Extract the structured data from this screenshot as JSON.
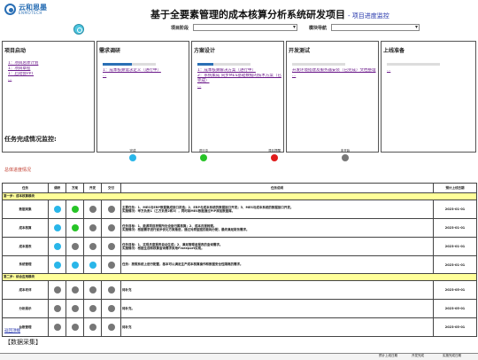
{
  "logo": {
    "main": "云和恩墨",
    "sub": "ENMOTECH"
  },
  "header": {
    "title": "基于全要素管理的成本核算分析系统研发项目",
    "subtitle": "- 项目进度监控"
  },
  "filters": {
    "project_label": "项目阶段",
    "project_value": "",
    "module_label": "模块导航",
    "module_value": ""
  },
  "phases": [
    {
      "title": "项目启动",
      "progress": 0,
      "links": [
        "1：项目总体计划",
        "1：项目章程",
        "1：启动会PPT",
        "..."
      ]
    },
    {
      "title": "需求调研",
      "progress": 0.55,
      "links": [
        "1：成本核算需求定义（进行中）",
        "..."
      ]
    },
    {
      "title": "方案设计",
      "progress": 0.3,
      "links": [
        "1：成本核算解决方案（进行中）",
        "2：系统集成 同步MES基础数据的技术方案（已完成）",
        "..."
      ]
    },
    {
      "title": "开发测试",
      "progress": 0,
      "links": [
        "开发环境搭建及服务器安装（已完成）文档整理",
        "..."
      ]
    },
    {
      "title": "上线准备",
      "progress": 0,
      "links": [
        "..."
      ]
    }
  ],
  "monitor": {
    "title": "任务完成情况监控:"
  },
  "legend": [
    {
      "label": "完成",
      "color": "#29b6e9"
    },
    {
      "label": "进行中",
      "color": "#27c427"
    },
    {
      "label": "滞后提醒",
      "color": "#e01b1b"
    },
    {
      "label": "未开始",
      "color": "#777777"
    }
  ],
  "overall_label": "总体进度情况",
  "table": {
    "headers": [
      "任务",
      "调研",
      "方案",
      "开发",
      "交付",
      "任务说明",
      "预计上线日期"
    ],
    "groups": [
      {
        "name": "第一步：成本核算模块",
        "rows": [
          {
            "task": "数据采集",
            "status": [
              "blue",
              "green",
              "gray",
              "gray"
            ],
            "desc1": "主要任务：1、MES与ERP数据集成接口改造；2、ERP与成本系统的数据接口开发；3、MES与成本系统的数据接口开发。",
            "desc2": "实施情况：甲方负责1（乙方负责2和3），同时将MES数据通过PIP添加数据库。",
            "date": "2023-01-01"
          },
          {
            "task": "成本核算",
            "status": [
              "blue",
              "green",
              "gray",
              "gray"
            ],
            "desc1": "任务目标：1、能源项目按照所处设备归属核算；2、成本月报梳理。",
            "desc2": "实施情况：根据需求进行逐步优化方案推进，通过对原型图的能耗分配，最终满足财务需求。",
            "date": "2023-01-01"
          },
          {
            "task": "成本报表",
            "status": [
              "blue",
              "gray",
              "gray",
              "gray"
            ],
            "desc1": "任务目标：1、实现月度报表自动生成；2、满足管理者报表的查询需求。",
            "desc2": "实施情况：根据生成和核算查询需求采用Fineeport实现。",
            "date": "2023-01-01"
          },
          {
            "task": "系统管理",
            "status": [
              "blue",
              "blue",
              "blue",
              "gray"
            ],
            "desc1": "任务：按照系统上进行配置，基本可以满足生产成本核算操作和数据安全性隔离的需求。",
            "desc2": "",
            "date": "2023-01-01"
          }
        ]
      },
      {
        "name": "第二步：综合应用模块",
        "rows": [
          {
            "task": "成本考评",
            "status": [
              "gray",
              "gray",
              "gray",
              "gray"
            ],
            "desc1": "待补充",
            "desc2": "",
            "date": "2023-05-01"
          },
          {
            "task": "分析展示",
            "status": [
              "gray",
              "gray",
              "gray",
              "gray"
            ],
            "desc1": "待补充。",
            "desc2": "",
            "date": "2023-05-01"
          },
          {
            "task": "台账管理",
            "status": [
              "gray",
              "gray",
              "gray",
              "gray"
            ],
            "desc1": "待补充",
            "desc2": "",
            "date": "2023-05-01"
          }
        ]
      }
    ]
  },
  "back_link": "返回顶端",
  "data_section": "【数据采集】",
  "bottom_headers": [
    "预计上线日期",
    "开发完成",
    "实施完成日期"
  ]
}
